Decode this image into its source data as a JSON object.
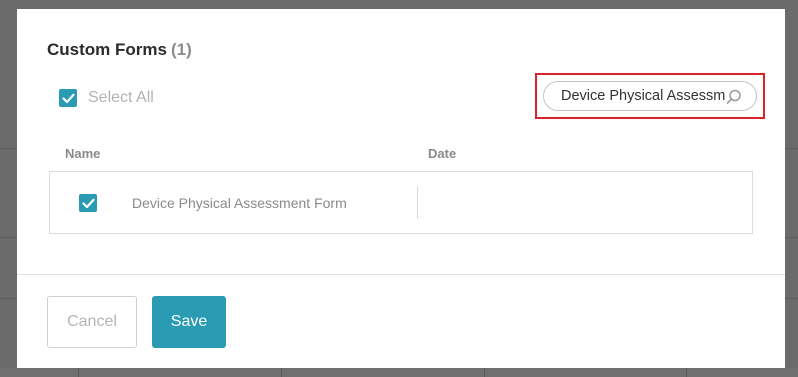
{
  "modal": {
    "title": "Custom Forms",
    "count": "(1)"
  },
  "select_all": {
    "label": "Select All",
    "checked": true
  },
  "search": {
    "value": "Device Physical Assessment Form"
  },
  "table": {
    "columns": [
      "Name",
      "Date"
    ],
    "rows": [
      {
        "name": "Device Physical Assessment Form",
        "date": "",
        "checked": true
      }
    ]
  },
  "buttons": {
    "cancel_label": "Cancel",
    "save_label": "Save"
  },
  "colors": {
    "accent": "#2b9ab3",
    "highlight": "#d9232d"
  },
  "icons": {
    "check": "check-icon",
    "search": "search-icon"
  }
}
